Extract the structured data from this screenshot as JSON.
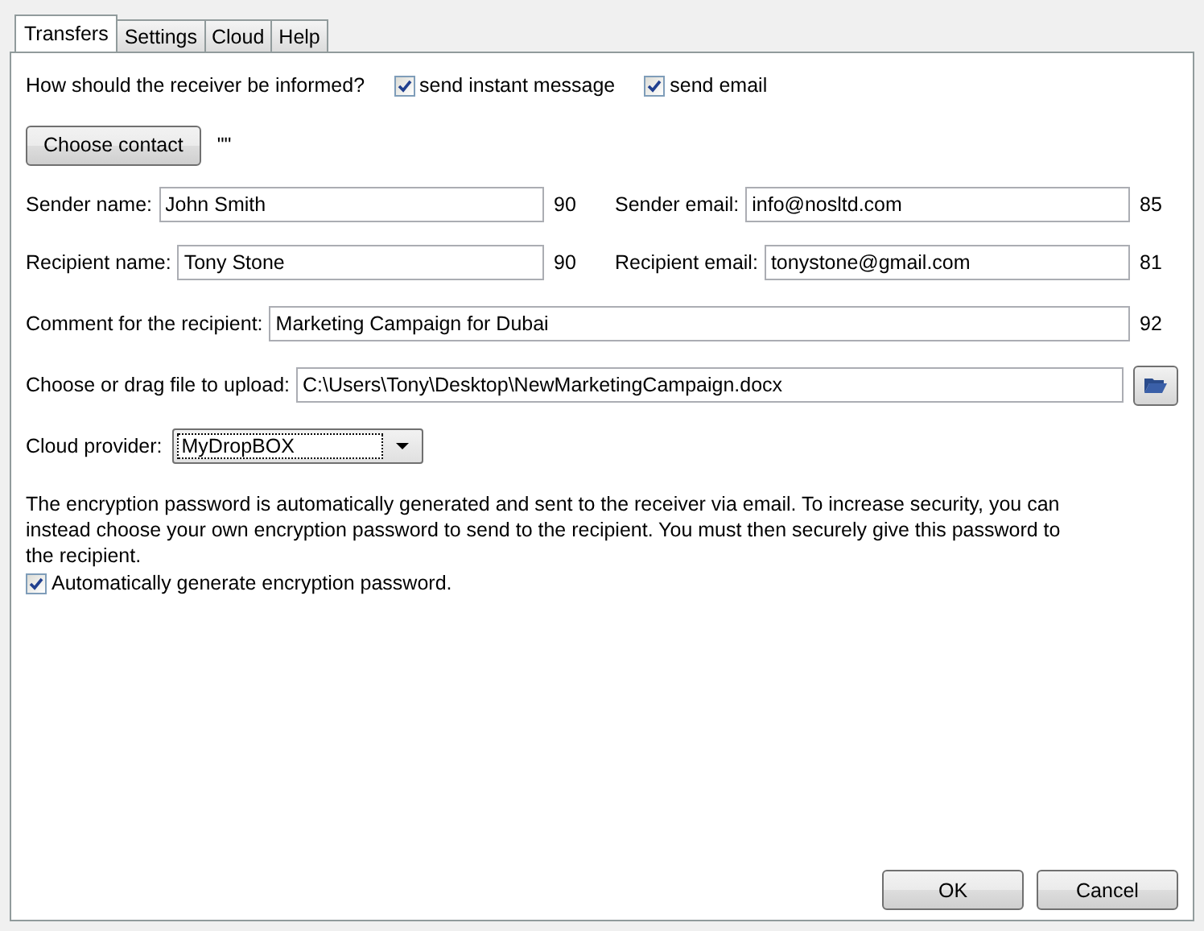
{
  "tabs": [
    {
      "label": "Transfers",
      "selected": true
    },
    {
      "label": "Settings",
      "selected": false
    },
    {
      "label": "Cloud",
      "selected": false
    },
    {
      "label": "Help",
      "selected": false
    }
  ],
  "notify": {
    "question": "How should the receiver be informed?",
    "options": [
      {
        "label": "send instant message",
        "checked": true
      },
      {
        "label": "send email",
        "checked": true
      }
    ]
  },
  "contact": {
    "button": "Choose contact",
    "value": "\"\""
  },
  "pair_rows": [
    [
      {
        "label": "Sender name:",
        "value": "John Smith",
        "count": "90"
      },
      {
        "label": "Sender email:",
        "value": "info@nosltd.com",
        "count": "85"
      }
    ],
    [
      {
        "label": "Recipient name:",
        "value": "Tony Stone",
        "count": "90"
      },
      {
        "label": "Recipient email:",
        "value": "tonystone@gmail.com",
        "count": "81"
      }
    ]
  ],
  "comment": {
    "label": "Comment for the recipient:",
    "value": "Marketing Campaign for Dubai",
    "count": "92"
  },
  "file": {
    "label": "Choose or drag file to upload:",
    "value": "C:\\Users\\Tony\\Desktop\\NewMarketingCampaign.docx"
  },
  "cloud": {
    "label": "Cloud provider:",
    "value": "MyDropBOX"
  },
  "info": "The encryption password is automatically generated and sent to the receiver via email. To increase security, you can instead choose your own encryption password to send to the recipient. You must then securely give this password to the recipient.",
  "auto_password": {
    "label": "Automatically generate encryption password.",
    "checked": true
  },
  "buttons": [
    "OK",
    "Cancel"
  ]
}
